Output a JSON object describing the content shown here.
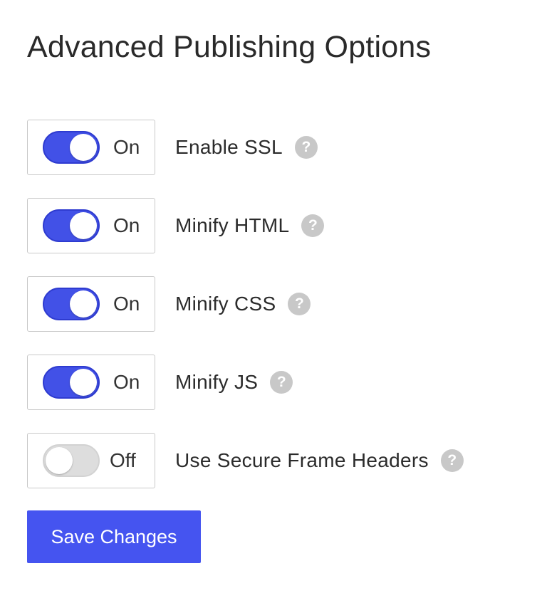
{
  "page": {
    "title": "Advanced Publishing Options"
  },
  "options": [
    {
      "label": "Enable SSL",
      "state": "On",
      "enabled": true
    },
    {
      "label": "Minify HTML",
      "state": "On",
      "enabled": true
    },
    {
      "label": "Minify CSS",
      "state": "On",
      "enabled": true
    },
    {
      "label": "Minify JS",
      "state": "On",
      "enabled": true
    },
    {
      "label": "Use Secure Frame Headers",
      "state": "Off",
      "enabled": false
    }
  ],
  "help_icon": {
    "glyph": "?",
    "icon": "question-mark-icon"
  },
  "actions": {
    "save_label": "Save Changes"
  },
  "colors": {
    "accent": "#4554f0",
    "toggle_on": "#4251e7",
    "toggle_off": "#dddddd",
    "help_icon_bg": "#c8c8c8"
  }
}
